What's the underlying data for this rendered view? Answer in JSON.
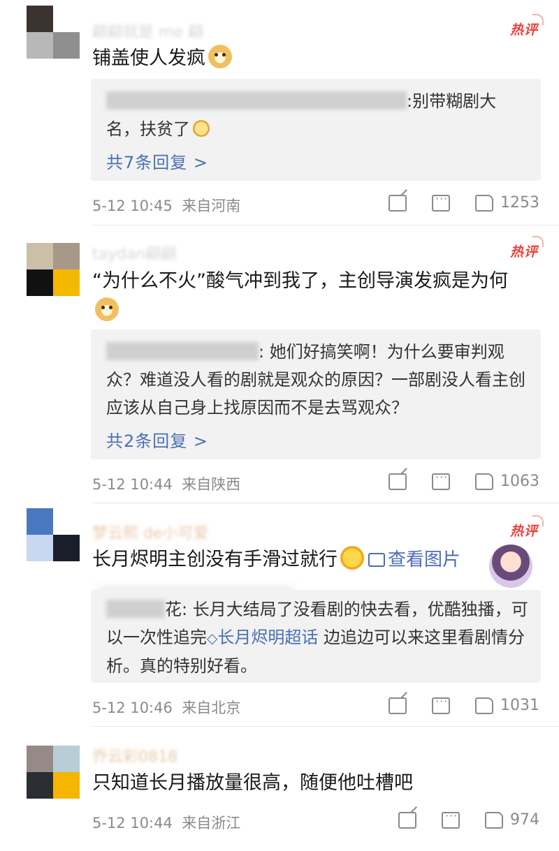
{
  "hot_label": "热评",
  "comments": [
    {
      "username": "翩翩就是 me 翩",
      "text": "铺盖使人发疯",
      "emoji": "doge-emoji",
      "reply": {
        "text": ":别带糊剧大名，扶贫了"
      },
      "reply_count": "共7条回复 >",
      "time": "5-12 10:45",
      "location": "来自河南",
      "likes": "1253"
    },
    {
      "username": "taydan翩翩",
      "text": "“为什么不火”酸气冲到我了，主创导演发疯是为何",
      "emoji": "doge-emoji",
      "reply": {
        "text": ": 她们好搞笑啊！为什么要审判观众？难道没人看的剧就是观众的原因？一部剧没人看主创应该从自己身上找原因而不是去骂观众？"
      },
      "reply_count": "共2条回复 >",
      "time": "5-12 10:44",
      "location": "来自陕西",
      "likes": "1063"
    },
    {
      "username": "梦云熙 de小可爱",
      "text": "长月烬明主创没有手滑过就行",
      "emoji": "laugh-emoji",
      "image_link": "查看图片",
      "reply": {
        "name_tail": "花",
        "text_before": ": 长月大结局了没看剧的快去看，优酷独播，可以一次性追完",
        "topic": "长月烬明超话",
        "text_after": " 边追边可以来这里看剧情分析。真的特别好看。"
      },
      "time": "5-12 10:46",
      "location": "来自北京",
      "likes": "1031"
    },
    {
      "username": "乔云彩0818",
      "text": "只知道长月播放量很高，随便他吐槽吧",
      "time": "5-12 10:44",
      "location": "来自浙江",
      "likes": "974"
    }
  ]
}
